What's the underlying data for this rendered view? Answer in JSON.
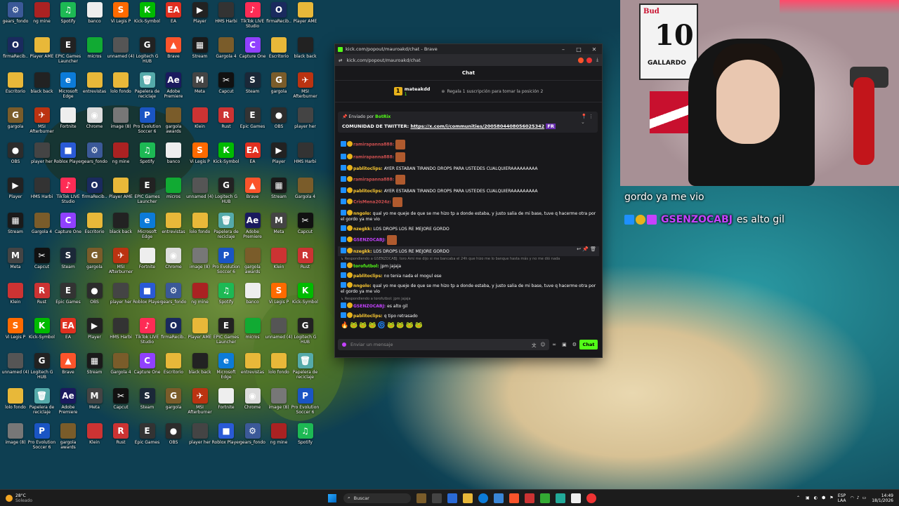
{
  "desktop": {
    "icons": [
      {
        "label": "gears_fondo",
        "color": "#3b5998",
        "glyph": "⚙"
      },
      {
        "label": "firmaRecib..",
        "color": "#1a2a5e",
        "glyph": "O"
      },
      {
        "label": "Escritorio",
        "color": "#e8b839",
        "glyph": ""
      },
      {
        "label": "gargola",
        "color": "#7a5c2a",
        "glyph": "G"
      },
      {
        "label": "OBS",
        "color": "#2c2c2c",
        "glyph": "●"
      },
      {
        "label": "Player",
        "color": "#222",
        "glyph": "▶"
      },
      {
        "label": "Stream",
        "color": "#1a1a1a",
        "glyph": "▦"
      },
      {
        "label": "Meta",
        "color": "#444",
        "glyph": "M"
      },
      {
        "label": "Klein",
        "color": "#c33",
        "glyph": ""
      },
      {
        "label": "Vi Legis P",
        "color": "#ff6a00",
        "glyph": "S"
      },
      {
        "label": "unnamed (4)",
        "color": "#555",
        "glyph": ""
      },
      {
        "label": "lolo fondo",
        "color": "#e8b839",
        "glyph": ""
      },
      {
        "label": "image (8)",
        "color": "#777",
        "glyph": ""
      },
      {
        "label": "ng mine",
        "color": "#a22",
        "glyph": ""
      },
      {
        "label": "Player AME",
        "color": "#e8b839",
        "glyph": ""
      },
      {
        "label": "black back",
        "color": "#222",
        "glyph": ""
      },
      {
        "label": "MSI Afterburner",
        "color": "#b31",
        "glyph": "✈"
      },
      {
        "label": "player her",
        "color": "#444",
        "glyph": ""
      },
      {
        "label": "HMS Harbi",
        "color": "#333",
        "glyph": ""
      },
      {
        "label": "Gargola 4",
        "color": "#7a5c2a",
        "glyph": ""
      },
      {
        "label": "Capcut",
        "color": "#111",
        "glyph": "✂"
      },
      {
        "label": "Rust",
        "color": "#c33",
        "glyph": "R"
      },
      {
        "label": "Kick-Symbol",
        "color": "#0b0",
        "glyph": "K"
      },
      {
        "label": "Logitech G HUB",
        "color": "#222",
        "glyph": "G"
      },
      {
        "label": "Papelera de reciclaje",
        "color": "#5aa",
        "glyph": "🗑"
      },
      {
        "label": "Pro Evolution Soccer 6",
        "color": "#1a55c4",
        "glyph": "P"
      },
      {
        "label": "Spotify",
        "color": "#1db954",
        "glyph": "♫"
      },
      {
        "label": "EPIC Games Launcher",
        "color": "#222",
        "glyph": "E"
      },
      {
        "label": "Microsoft Edge",
        "color": "#0c7bd8",
        "glyph": "e"
      },
      {
        "label": "Fortnite",
        "color": "#eee",
        "glyph": ""
      },
      {
        "label": "Roblox Player",
        "color": "#2a5ad6",
        "glyph": "■"
      },
      {
        "label": "TikTok LIVE Studio",
        "color": "#fe2c55",
        "glyph": "♪"
      },
      {
        "label": "Capture One",
        "color": "#9040ff",
        "glyph": "C"
      },
      {
        "label": "Steam",
        "color": "#1b2838",
        "glyph": "S"
      },
      {
        "label": "Epic Games",
        "color": "#333",
        "glyph": "E"
      },
      {
        "label": "EA",
        "color": "#e03020",
        "glyph": "EA"
      },
      {
        "label": "Brave",
        "color": "#fb542b",
        "glyph": "▲"
      },
      {
        "label": "Adobe Premiere",
        "color": "#1a1a5e",
        "glyph": "Ae"
      },
      {
        "label": "gargola awards",
        "color": "#7a5c2a",
        "glyph": ""
      },
      {
        "label": "banco",
        "color": "#eee",
        "glyph": ""
      },
      {
        "label": "micros",
        "color": "#1a3",
        "glyph": ""
      },
      {
        "label": "entrevistas",
        "color": "#e8b839",
        "glyph": ""
      },
      {
        "label": "Chrome",
        "color": "#ddd",
        "glyph": "◉"
      }
    ]
  },
  "browser": {
    "window_title": "kick.com/popout/mauroakd/chat - Brave",
    "url": "kick.com/popout/mauroakd/chat",
    "chat_header": "Chat",
    "subgoal": {
      "rank": "1",
      "user": "mateakdd",
      "count": "1",
      "text": "Regala 1 suscripción para tomar la posición 2"
    },
    "pinned": {
      "by_label": "Enviado por",
      "by_user": "BotRix",
      "text": "COMUNIDAD DE TWITTER:",
      "link": "https://x.com/i/communities/2005804408056025342",
      "suffix": "FR"
    },
    "messages": [
      {
        "reply": "",
        "user": "ramirapanna888",
        "color": "#d05050",
        "text": "",
        "emote": true
      },
      {
        "reply": "",
        "user": "ramirapanna888",
        "color": "#d05050",
        "text": "",
        "emote": true
      },
      {
        "reply": "",
        "user": "pablitoclips",
        "color": "#ffcc33",
        "text": "AYER ESTABAN TIRANDO DROPS PARA USTEDES CUALQUIERAAAAAAAAA",
        "emote": false
      },
      {
        "reply": "",
        "user": "ramirapanna888",
        "color": "#d05050",
        "text": "",
        "emote": true
      },
      {
        "reply": "",
        "user": "pablitoclips",
        "color": "#ffcc33",
        "text": "AYER ESTABAN TIRANDO DROPS PARA USTEDES CUALQUIERAAAAAAAAA",
        "emote": false
      },
      {
        "reply": "",
        "user": "CrisMena2024z",
        "color": "#d05050",
        "text": "",
        "emote": true
      },
      {
        "reply": "",
        "user": "nngolo",
        "color": "#ffcc33",
        "text": "qual yo me queje de que se me hizo tp a donde estaba, y justo salia de mi base, tuve q hacerme otra por el gordo ya me vio",
        "emote": false
      },
      {
        "reply": "",
        "user": "nzegkk",
        "color": "#ffcc33",
        "text": "LOS DROPS LOS RE MEJORE GORDO",
        "emote": false
      },
      {
        "reply": "",
        "user": "GSENZOCABJ",
        "color": "#c542ff",
        "text": "",
        "emote": true
      },
      {
        "reply": "",
        "user": "nzegkk",
        "color": "#ffcc33",
        "text": "LOS DROPS LOS RE MEJORE GORDO",
        "emote": false,
        "hl": true
      },
      {
        "reply": "Respondiendo a GSENZOCABJ: toro Ami me dijo si me bancaba el 24h que hizo me lo banque hasta más y no me dió nada",
        "user": "torofutbol",
        "color": "#53fc18",
        "text": "jpm jajaja",
        "emote": false
      },
      {
        "reply": "",
        "user": "pablitoclips",
        "color": "#ffcc33",
        "text": "no tenia nada el mogul ese",
        "emote": false
      },
      {
        "reply": "",
        "user": "nngolo",
        "color": "#ffcc33",
        "text": "qual yo me queje de que se me hizo tp a donde estaba, y justo salia de mi base, tuve q hacerme otra por el gordo ya me vio",
        "emote": false
      },
      {
        "reply": "Respondiendo a torofutbol: jpm jajaja",
        "user": "GSENZOCABJ",
        "color": "#c542ff",
        "text": "es alto gil",
        "emote": false
      },
      {
        "reply": "",
        "user": "pablitoclips",
        "color": "#ffcc33",
        "text": "q tipo retrasado",
        "emote": false
      }
    ],
    "emote_row": "🔥🐸🐸🐸🌀🐸🐸🐸🐸",
    "input_placeholder": "Enviar un mensaje",
    "send_button": "Chat"
  },
  "overlay": {
    "line1": "gordo ya me vio",
    "line2_user": "GSENZOCABJ",
    "line2_text": "es alto gil"
  },
  "webcam": {
    "jersey_number": "10",
    "jersey_name": "GALLARDO",
    "brand": "Bud"
  },
  "taskbar": {
    "weather_temp": "28°C",
    "weather_desc": "Soleado",
    "search_label": "Buscar",
    "lang": "ESP",
    "lang_sub": "LAA",
    "time": "14:49",
    "date": "18/1/2026"
  },
  "colors": {
    "kick_green": "#53fc18",
    "chat_bg": "#18181b"
  }
}
